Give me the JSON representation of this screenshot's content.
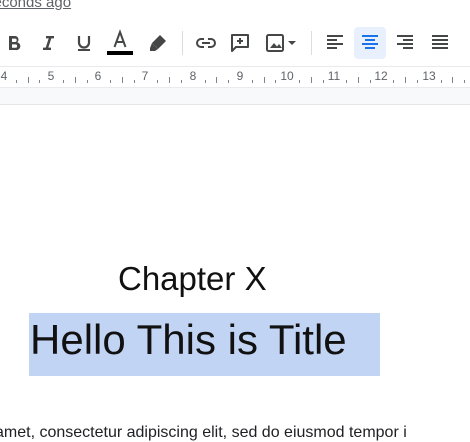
{
  "header": {
    "last_edit": "seconds ago"
  },
  "toolbar": {
    "text_color": "#000000",
    "accent": "#1a73e8",
    "buttons": [
      "bold",
      "italic",
      "underline",
      "text-color",
      "highlight",
      "link",
      "comment",
      "image",
      "align-left",
      "align-center",
      "align-right",
      "justify"
    ],
    "active": "align-center"
  },
  "ruler": {
    "labels": [
      "4",
      "5",
      "6",
      "7",
      "8",
      "9",
      "10",
      "11",
      "12",
      "13"
    ]
  },
  "document": {
    "chapter": "Chapter X",
    "title": "Hello This is Title",
    "body": "amet, consectetur adipiscing elit, sed do eiusmod tempor i",
    "selection_color": "#c2d4f4"
  }
}
